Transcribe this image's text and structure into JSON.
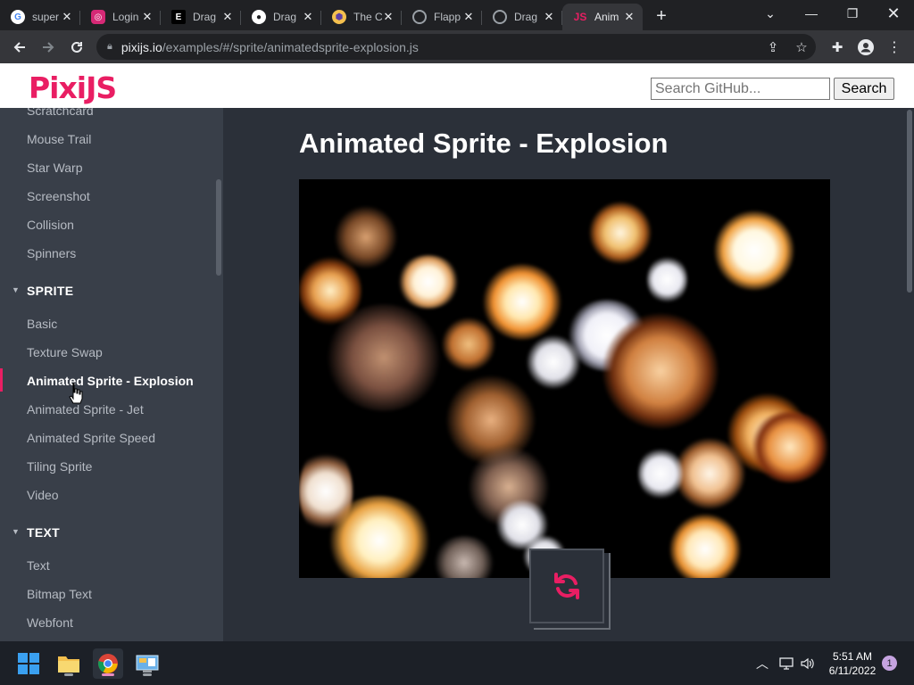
{
  "browser": {
    "tabs": [
      {
        "title": "super",
        "favicon": "google-icon",
        "color": "#ffffff"
      },
      {
        "title": "Login",
        "favicon": "instagram-icon",
        "color": "#d62976"
      },
      {
        "title": "Drag",
        "favicon": "e-icon",
        "color": "#000000"
      },
      {
        "title": "Drag",
        "favicon": "github-icon",
        "color": "#ffffff"
      },
      {
        "title": "The C",
        "favicon": "hexagon-icon",
        "color": "#f4c04e"
      },
      {
        "title": "Flapp",
        "favicon": "globe-icon",
        "color": "#9aa0a6"
      },
      {
        "title": "Drag",
        "favicon": "globe-icon",
        "color": "#9aa0a6"
      },
      {
        "title": "Anim",
        "favicon": "pixijs-icon",
        "color": "#e91e63"
      }
    ],
    "active_tab_index": 7,
    "url_host": "pixijs.io",
    "url_path": "/examples/#/sprite/animatedsprite-explosion.js"
  },
  "site": {
    "logo": "PixiJS",
    "search_placeholder": "Search GitHub...",
    "search_button": "Search"
  },
  "sidebar": {
    "items_top": [
      "Scratchcard",
      "Mouse Trail",
      "Star Warp",
      "Screenshot",
      "Collision",
      "Spinners"
    ],
    "sections": [
      {
        "title": "SPRITE",
        "items": [
          "Basic",
          "Texture Swap",
          "Animated Sprite - Explosion",
          "Animated Sprite - Jet",
          "Animated Sprite Speed",
          "Tiling Sprite",
          "Video"
        ]
      },
      {
        "title": "TEXT",
        "items": [
          "Text",
          "Bitmap Text",
          "Webfont"
        ]
      }
    ],
    "active_item": "Animated Sprite - Explosion"
  },
  "main": {
    "title": "Animated Sprite - Explosion"
  },
  "taskbar": {
    "time": "5:51 AM",
    "date": "6/11/2022",
    "notification_count": "1"
  },
  "colors": {
    "accent": "#e91e63",
    "sidebar_bg": "#393f49",
    "main_bg": "#2b3039"
  }
}
